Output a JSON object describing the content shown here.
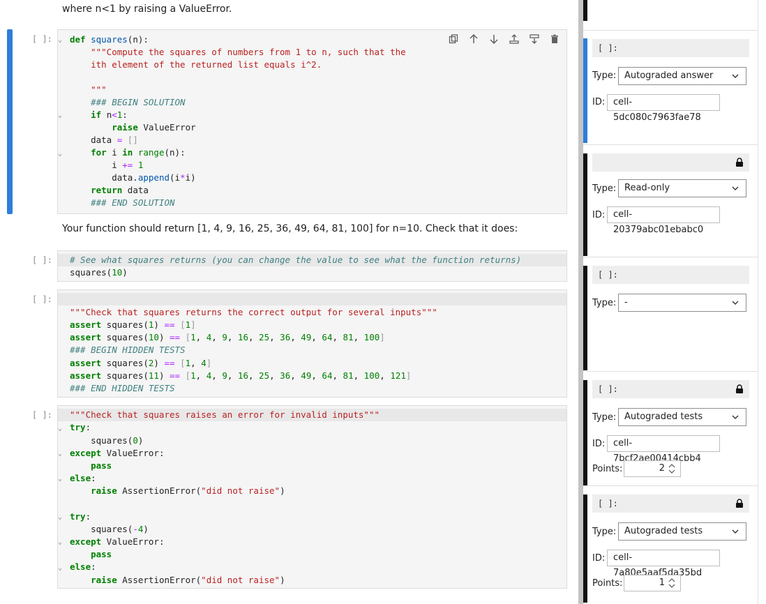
{
  "notebook": {
    "intro_text": "where n<1 by raising a ValueError.",
    "mid_text": "Your function should return [1, 4, 9, 16, 25, 36, 49, 64, 81, 100] for n=10. Check that it does:",
    "prompt": "[ ]:",
    "cells": [
      {
        "lines": [
          "def squares(n):",
          "    \"\"\"Compute the squares of numbers from 1 to n, such that the",
          "    ith element of the returned list equals i^2.",
          "",
          "    \"\"\"",
          "    ### BEGIN SOLUTION",
          "    if n<1:",
          "        raise ValueError",
          "    data = []",
          "    for i in range(n):",
          "        i += 1",
          "        data.append(i*i)",
          "    return data",
          "    ### END SOLUTION"
        ]
      },
      {
        "lines": [
          "# See what squares returns (you can change the value to see what the function returns)",
          "squares(10)"
        ]
      },
      {
        "lines": [
          "",
          "\"\"\"Check that squares returns the correct output for several inputs\"\"\"",
          "assert squares(1) == [1]",
          "assert squares(10) == [1, 4, 9, 16, 25, 36, 49, 64, 81, 100]",
          "### BEGIN HIDDEN TESTS",
          "assert squares(2) == [1, 4]",
          "assert squares(11) == [1, 4, 9, 16, 25, 36, 49, 64, 81, 100, 121]",
          "### END HIDDEN TESTS"
        ]
      },
      {
        "lines": [
          "\"\"\"Check that squares raises an error for invalid inputs\"\"\"",
          "try:",
          "    squares(0)",
          "except ValueError:",
          "    pass",
          "else:",
          "    raise AssertionError(\"did not raise\")",
          "",
          "try:",
          "    squares(-4)",
          "except ValueError:",
          "    pass",
          "else:",
          "    raise AssertionError(\"did not raise\")"
        ]
      }
    ]
  },
  "sidebar": {
    "type_label": "Type:",
    "id_label": "ID:",
    "points_label": "Points:",
    "cells": [
      {
        "prompt": "[ ]:",
        "type": "Autograded answer",
        "id": "cell-5dc080c7963fae78",
        "locked": false
      },
      {
        "prompt": "",
        "type": "Read-only",
        "id": "cell-20379abc01ebabc0",
        "locked": true
      },
      {
        "prompt": "[ ]:",
        "type": "-",
        "locked": false
      },
      {
        "prompt": "[ ]:",
        "type": "Autograded tests",
        "id": "cell-7bcf2ae00414cbb4",
        "points": "2",
        "locked": true
      },
      {
        "prompt": "[ ]:",
        "type": "Autograded tests",
        "id": "cell-7a80e5aaf5da35bd",
        "points": "1",
        "locked": true
      }
    ]
  },
  "icons": [
    "copy-icon",
    "move-up-icon",
    "move-down-icon",
    "insert-above-icon",
    "insert-below-icon",
    "delete-icon",
    "lock-icon",
    "chevron-down-icon",
    "spinner-icon",
    "fold-arrow-icon"
  ],
  "colors": {
    "active": "#2f7ed8",
    "keyword": "#008000",
    "string": "#ba2121",
    "comment": "#408080"
  }
}
